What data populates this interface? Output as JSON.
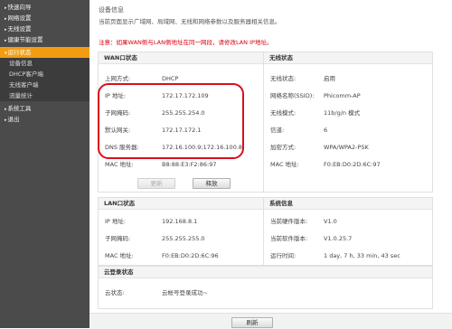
{
  "sidebar": {
    "items": [
      {
        "label": "快速向导",
        "arrow": "▸",
        "active": false,
        "sub": false
      },
      {
        "label": "网络设置",
        "arrow": "▸",
        "active": false,
        "sub": false
      },
      {
        "label": "无线设置",
        "arrow": "▸",
        "active": false,
        "sub": false
      },
      {
        "label": "健康节能设置",
        "arrow": "▸",
        "active": false,
        "sub": false
      },
      {
        "label": "运行状态",
        "arrow": "▾",
        "active": true,
        "sub": false
      },
      {
        "label": "设备信息",
        "arrow": "",
        "active": false,
        "sub": true
      },
      {
        "label": "DHCP客户端",
        "arrow": "",
        "active": false,
        "sub": true
      },
      {
        "label": "无线客户端",
        "arrow": "",
        "active": false,
        "sub": true
      },
      {
        "label": "流量统计",
        "arrow": "",
        "active": false,
        "sub": true
      },
      {
        "label": "系统工具",
        "arrow": "▸",
        "active": false,
        "sub": false
      },
      {
        "label": "退出",
        "arrow": "▸",
        "active": false,
        "sub": false
      }
    ]
  },
  "header": {
    "title": "设备信息",
    "description": "当前页面显示广域网、局域网、无线和网络参数以及服务器相关信息。",
    "notice": "注意：如果WAN侧与LAN侧地址在同一网段，请修改LAN IP地址。"
  },
  "wan": {
    "title": "WAN口状态",
    "rows": [
      {
        "label": "上网方式:",
        "value": "DHCP"
      },
      {
        "label": "IP 地址:",
        "value": "172.17.172.109"
      },
      {
        "label": "子网掩码:",
        "value": "255.255.254.0"
      },
      {
        "label": "默认网关:",
        "value": "172.17.172.1"
      },
      {
        "label": "DNS 服务器:",
        "value": "172.16.100.9;172.16.100.8"
      },
      {
        "label": "MAC 地址:",
        "value": "B8:88:E3:F2:86:97"
      }
    ],
    "buttons": {
      "renew": "更新",
      "release": "释放"
    }
  },
  "wireless": {
    "title": "无线状态",
    "rows": [
      {
        "label": "无线状态:",
        "value": "启用"
      },
      {
        "label": "网络名称(SSID):",
        "value": "Phicomm-AP"
      },
      {
        "label": "无线模式:",
        "value": "11b/g/n 模式"
      },
      {
        "label": "信道:",
        "value": "6"
      },
      {
        "label": "加密方式:",
        "value": "WPA/WPA2-PSK"
      },
      {
        "label": "MAC 地址:",
        "value": "F0:EB:D0:2D:6C:97"
      }
    ]
  },
  "lan": {
    "title": "LAN口状态",
    "rows": [
      {
        "label": "IP 地址:",
        "value": "192.168.8.1"
      },
      {
        "label": "子网掩码:",
        "value": "255.255.255.0"
      },
      {
        "label": "MAC 地址:",
        "value": "F0:EB:D0:2D:6C:96"
      }
    ]
  },
  "system": {
    "title": "系统信息",
    "rows": [
      {
        "label": "当前硬件版本:",
        "value": "V1.0"
      },
      {
        "label": "当前软件版本:",
        "value": "V1.0.25.7"
      },
      {
        "label": "运行时间:",
        "value": "1 day, 7 h, 33 min, 43 sec"
      }
    ]
  },
  "cloud": {
    "title": "云登录状态",
    "rows": [
      {
        "label": "云状态:",
        "value": "云帐号登录成功~"
      }
    ]
  },
  "footer": {
    "refresh": "刷新"
  }
}
